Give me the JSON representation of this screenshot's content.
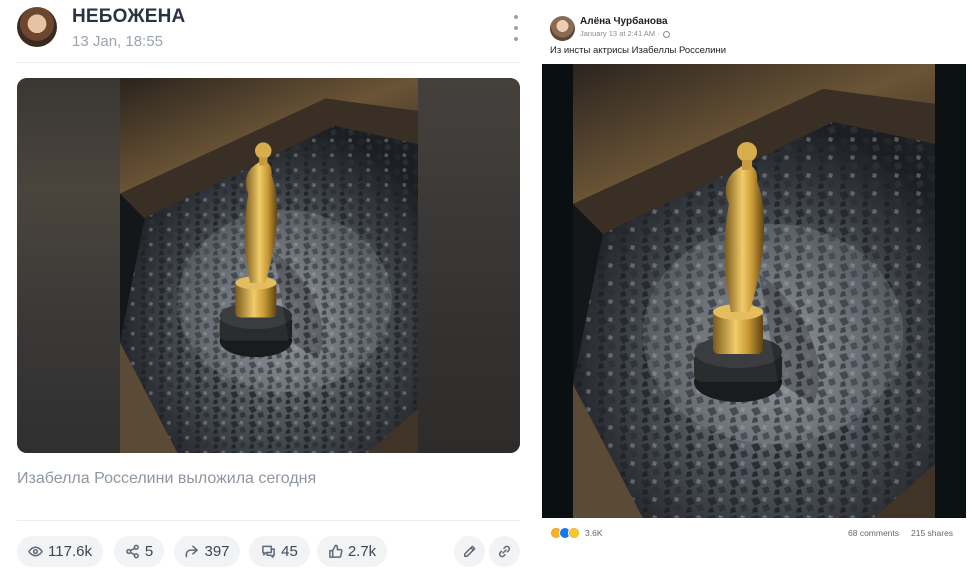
{
  "left_post": {
    "author": "НЕБОЖЕНА",
    "date": "13 Jan, 18:55",
    "caption": "Изабелла Росселини выложила сегодня",
    "stats": {
      "views": "117.6k",
      "shares": "5",
      "reposts": "397",
      "comments": "45",
      "likes": "2.7k"
    },
    "icons": [
      "eye-icon",
      "share-icon",
      "repost-icon",
      "comments-icon",
      "thumbs-up-icon",
      "pencil-icon",
      "link-icon",
      "more-vertical-icon"
    ]
  },
  "right_post": {
    "author": "Алёна Чурбанова",
    "date": "January 13 at 2:41 AM · ",
    "text": "Из инсты актрисы Изабеллы Росселини",
    "reactions_count": "3.6K",
    "comments": "68 comments",
    "shares": "215 shares",
    "reaction_icons": [
      "haha-emoji",
      "like-emoji",
      "wow-emoji"
    ]
  },
  "colors": {
    "left_author": "#2a3344",
    "muted": "#9aa3ae",
    "pill_bg": "#f1f3f5",
    "fb_text": "#1c1e21",
    "fb_muted": "#65676b"
  }
}
